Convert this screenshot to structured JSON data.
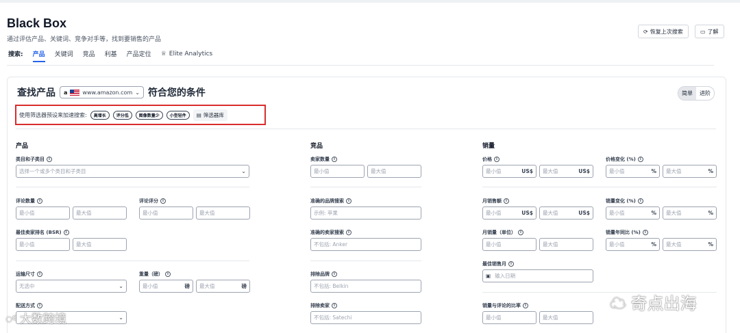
{
  "header": {
    "title": "Black Box",
    "subtitle": "通过评估产品、关键词、竞争对手等，找到要销售的产品",
    "restore_label": "恢复上次搜索",
    "learn_label": "了解"
  },
  "tabs": {
    "label": "搜索:",
    "items": [
      "产品",
      "关键词",
      "竞品",
      "利基",
      "产品定位",
      "Elite Analytics"
    ]
  },
  "find": {
    "title": "查找产品",
    "marketplace": "www.amazon.com",
    "title_suffix": "符合您的条件",
    "mode_simple": "简单",
    "mode_advanced": "进阶"
  },
  "presets": {
    "text": "使用筛选器预设来加速搜索:",
    "chips": [
      "高增长",
      "评分低",
      "图像数量少",
      "小型轻件"
    ],
    "library": "筛选器库"
  },
  "sections": {
    "product": "产品",
    "competitors": "竞品",
    "sales": "销量"
  },
  "fields": {
    "category": {
      "label": "类目和子类目",
      "placeholder": "选择一个或多个类目和子类目"
    },
    "review_count": {
      "label": "评论数量",
      "min": "最小值",
      "max": "最大值"
    },
    "review_rating": {
      "label": "评论评分",
      "min": "最小值",
      "max": "最大值"
    },
    "bsr": {
      "label": "最佳卖家排名 (BSR)",
      "min": "最小值",
      "max": "最大值"
    },
    "shipping_size": {
      "label": "运输尺寸",
      "value": "无选中"
    },
    "weight": {
      "label": "重量（磅）",
      "min": "最小值",
      "max": "最大值",
      "unit": "磅"
    },
    "fulfillment": {
      "label": "配送方式"
    },
    "seller_count": {
      "label": "卖家数量",
      "min": "最小值",
      "max": "最大值"
    },
    "brand_search": {
      "label": "准确的品牌搜索",
      "placeholder": "示例: 苹果"
    },
    "seller_search": {
      "label": "准确的卖家搜索",
      "placeholder": "不包括: Anker"
    },
    "exclude_brand": {
      "label": "排除品牌",
      "placeholder": "不包括: Belkin"
    },
    "exclude_seller": {
      "label": "排除卖家",
      "placeholder": "不包括: Satechi"
    },
    "price": {
      "label": "价格",
      "min": "最小值",
      "max": "最大值",
      "unit": "US$"
    },
    "price_change": {
      "label": "价格变化 (%)",
      "min": "最小值",
      "max": "最大值",
      "unit": "%"
    },
    "monthly_revenue": {
      "label": "月销售额",
      "min": "最小值",
      "max": "最大值",
      "unit": "US$"
    },
    "sales_change": {
      "label": "销量变化 (%)",
      "min": "最小值",
      "max": "最大值",
      "unit": "%"
    },
    "monthly_units": {
      "label": "月销量（单位）",
      "min": "最小值",
      "max": "最大值"
    },
    "sales_yoy": {
      "label": "销量年同比 (%)",
      "min": "最小值",
      "max": "最大值",
      "unit": "%"
    },
    "best_month": {
      "label": "最佳销售月",
      "placeholder": "输入日期"
    },
    "sales_review_ratio": {
      "label": "销量与评论的比率",
      "min": "最小值",
      "max": "最大值"
    }
  },
  "watermarks": {
    "left": "大数跨境",
    "right": "奇点出海"
  }
}
